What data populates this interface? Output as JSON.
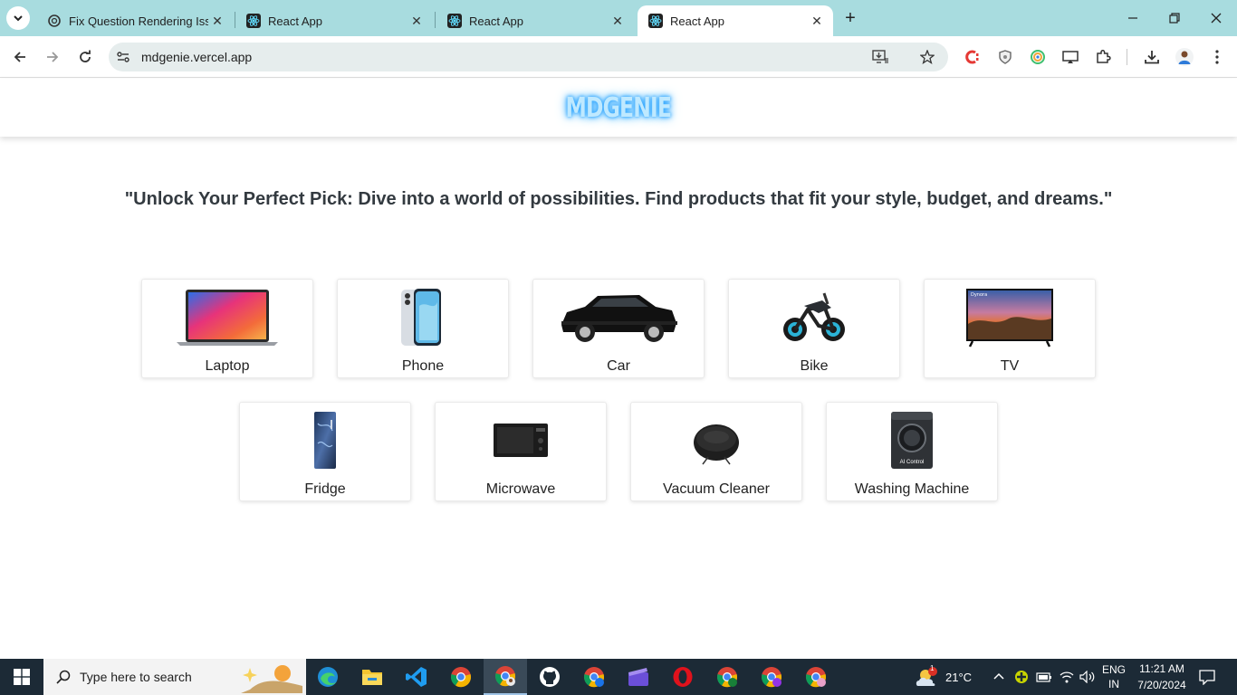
{
  "browser": {
    "tabs": [
      {
        "title": "Fix Question Rendering Issue",
        "active": false
      },
      {
        "title": "React App",
        "active": false
      },
      {
        "title": "React App",
        "active": false
      },
      {
        "title": "React App",
        "active": true
      }
    ],
    "url": "mdgenie.vercel.app"
  },
  "site": {
    "brand": "MDGENIE",
    "tagline": "\"Unlock Your Perfect Pick: Dive into a world of possibilities. Find products that fit your style, budget, and dreams.\"",
    "categories": [
      {
        "label": "Laptop",
        "icon": "laptop-icon"
      },
      {
        "label": "Phone",
        "icon": "phone-icon"
      },
      {
        "label": "Car",
        "icon": "car-icon"
      },
      {
        "label": "Bike",
        "icon": "bike-icon"
      },
      {
        "label": "TV",
        "icon": "tv-icon"
      },
      {
        "label": "Fridge",
        "icon": "fridge-icon"
      },
      {
        "label": "Microwave",
        "icon": "microwave-icon"
      },
      {
        "label": "Vacuum Cleaner",
        "icon": "vacuum-cleaner-icon"
      },
      {
        "label": "Washing Machine",
        "icon": "washing-machine-icon"
      }
    ],
    "washing_machine_badge": "AI Control",
    "tv_brand": "Dynora"
  },
  "taskbar": {
    "search_placeholder": "Type here to search",
    "weather": "21°C",
    "weather_alert": "1",
    "lang_top": "ENG",
    "lang_bottom": "IN",
    "time": "11:21 AM",
    "date": "7/20/2024"
  },
  "colors": {
    "tabbar": "#a8dcdf",
    "brand_glow": "#2fa6ff",
    "taskbar": "#1c2a36"
  }
}
